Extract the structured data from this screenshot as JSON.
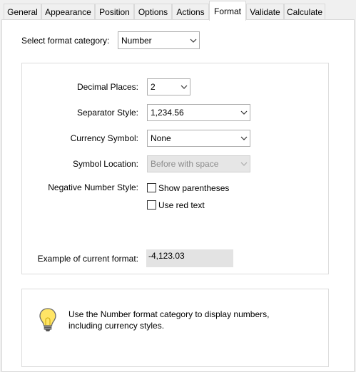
{
  "tabs": [
    {
      "label": "General"
    },
    {
      "label": "Appearance"
    },
    {
      "label": "Position"
    },
    {
      "label": "Options"
    },
    {
      "label": "Actions"
    },
    {
      "label": "Format",
      "active": true
    },
    {
      "label": "Validate"
    },
    {
      "label": "Calculate"
    }
  ],
  "format_category": {
    "label": "Select format category:",
    "value": "Number"
  },
  "number_options": {
    "decimal_places": {
      "label": "Decimal Places:",
      "value": "2"
    },
    "separator_style": {
      "label": "Separator Style:",
      "value": "1,234.56"
    },
    "currency_symbol": {
      "label": "Currency Symbol:",
      "value": "None"
    },
    "symbol_location": {
      "label": "Symbol Location:",
      "value": "Before with space",
      "disabled": true
    },
    "negative_number_style": {
      "label": "Negative Number Style:",
      "options": [
        {
          "label": "Show parentheses",
          "checked": false
        },
        {
          "label": "Use red text",
          "checked": false
        }
      ]
    },
    "example": {
      "label": "Example of current format:",
      "value": "-4,123.03"
    }
  },
  "hint": {
    "icon": "lightbulb-icon",
    "text_line1": "Use the Number format category to display numbers,",
    "text_line2": "including currency styles."
  }
}
